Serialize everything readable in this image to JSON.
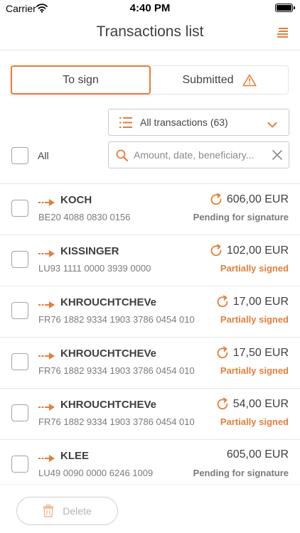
{
  "status_bar": {
    "carrier": "Carrier",
    "time": "4:40 PM"
  },
  "header": {
    "title": "Transactions list",
    "menu_icon": "menu-lines-icon"
  },
  "tabs": [
    {
      "label": "To sign",
      "selected": true
    },
    {
      "label": "Submitted",
      "selected": false,
      "icon": "warning-triangle-icon"
    }
  ],
  "filter": {
    "selected": "All transactions (63)"
  },
  "select_all": {
    "label": "All",
    "checked": false
  },
  "search": {
    "placeholder": "Amount, date, beneficiary...",
    "value": ""
  },
  "colors": {
    "accent": "#e57e39",
    "pending": "#7b7b7b",
    "partial": "#e57e39"
  },
  "transactions": [
    {
      "name": "KOCH",
      "iban": "BE20 4088 0830 0156",
      "amount": "606,00 EUR",
      "status": "Pending for signature",
      "status_kind": "pending",
      "refresh_icon": true
    },
    {
      "name": "KISSINGER",
      "iban": "LU93 1111 0000 3939 0000",
      "amount": "102,00 EUR",
      "status": "Partially signed",
      "status_kind": "partial",
      "refresh_icon": true
    },
    {
      "name": "KHROUCHTCHEVe",
      "iban": "FR76 1882 9334 1903 3786 0454 010",
      "amount": "17,00 EUR",
      "status": "Partially signed",
      "status_kind": "partial",
      "refresh_icon": true
    },
    {
      "name": "KHROUCHTCHEVe",
      "iban": "FR76 1882 9334 1903 3786 0454 010",
      "amount": "17,50 EUR",
      "status": "Partially signed",
      "status_kind": "partial",
      "refresh_icon": true
    },
    {
      "name": "KHROUCHTCHEVe",
      "iban": "FR76 1882 9334 1903 3786 0454 010",
      "amount": "54,00 EUR",
      "status": "Partially signed",
      "status_kind": "partial",
      "refresh_icon": true
    },
    {
      "name": "KLEE",
      "iban": "LU49 0090 0000 6246 1009",
      "amount": "605,00 EUR",
      "status": "Pending for signature",
      "status_kind": "pending",
      "refresh_icon": false
    }
  ],
  "footer": {
    "delete_label": "Delete",
    "delete_enabled": false
  }
}
